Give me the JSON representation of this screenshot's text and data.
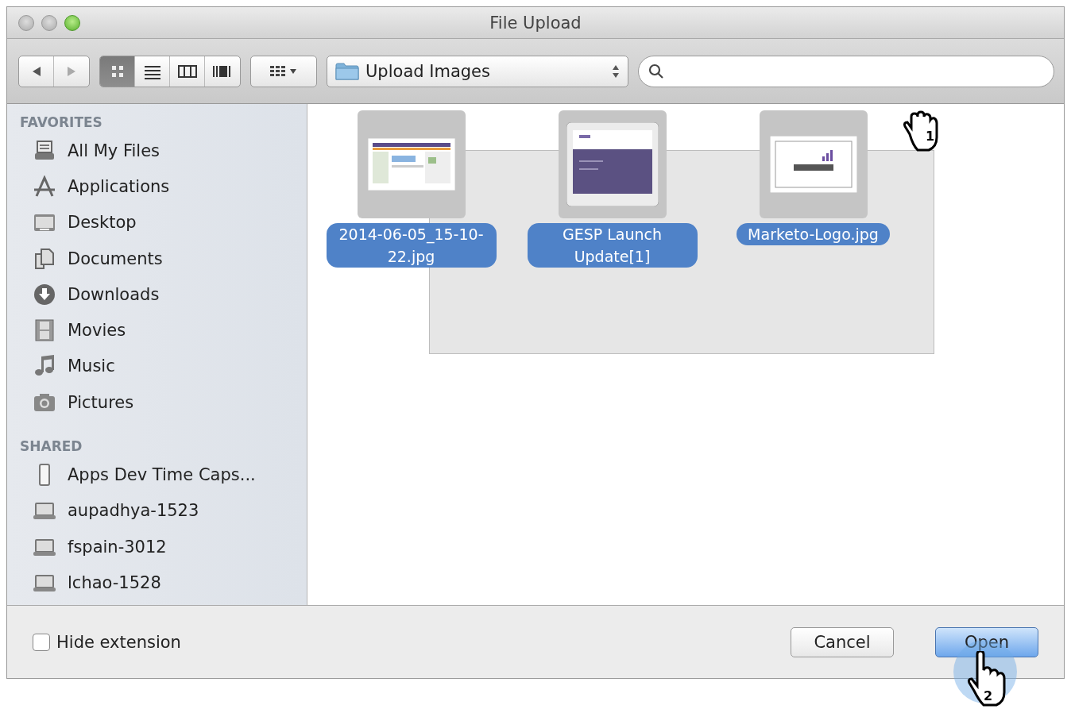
{
  "window": {
    "title": "File Upload"
  },
  "toolbar": {
    "view_buttons": [
      {
        "kind": "icons",
        "selected": true
      },
      {
        "kind": "list",
        "selected": false
      },
      {
        "kind": "columns",
        "selected": false
      },
      {
        "kind": "coverflow",
        "selected": false
      }
    ],
    "location": "Upload Images"
  },
  "sidebar": {
    "sections": [
      {
        "title": "FAVORITES",
        "items": [
          {
            "label": "All My Files",
            "kind": "files"
          },
          {
            "label": "Applications",
            "kind": "apps"
          },
          {
            "label": "Desktop",
            "kind": "desktop"
          },
          {
            "label": "Documents",
            "kind": "documents"
          },
          {
            "label": "Downloads",
            "kind": "downloads"
          },
          {
            "label": "Movies",
            "kind": "movies"
          },
          {
            "label": "Music",
            "kind": "music"
          },
          {
            "label": "Pictures",
            "kind": "pictures"
          }
        ]
      },
      {
        "title": "SHARED",
        "items": [
          {
            "label": "Apps Dev Time Caps...",
            "kind": "capsule"
          },
          {
            "label": "aupadhya-1523",
            "kind": "laptop"
          },
          {
            "label": "fspain-3012",
            "kind": "laptop"
          },
          {
            "label": "lchao-1528",
            "kind": "laptop"
          }
        ]
      }
    ]
  },
  "files": [
    {
      "name": "2014-06-05_15-10-22.jpg",
      "selected": true
    },
    {
      "name": "GESP Launch Update[1]",
      "selected": true
    },
    {
      "name": "Marketo-Logo.jpg",
      "selected": true
    }
  ],
  "footer": {
    "hide_extension": {
      "label": "Hide extension",
      "checked": false
    },
    "buttons": [
      {
        "label": "Cancel",
        "kind": "normal"
      },
      {
        "label": "Open",
        "kind": "default"
      }
    ]
  },
  "cursors": [
    {
      "label": "1"
    },
    {
      "label": "2"
    }
  ]
}
